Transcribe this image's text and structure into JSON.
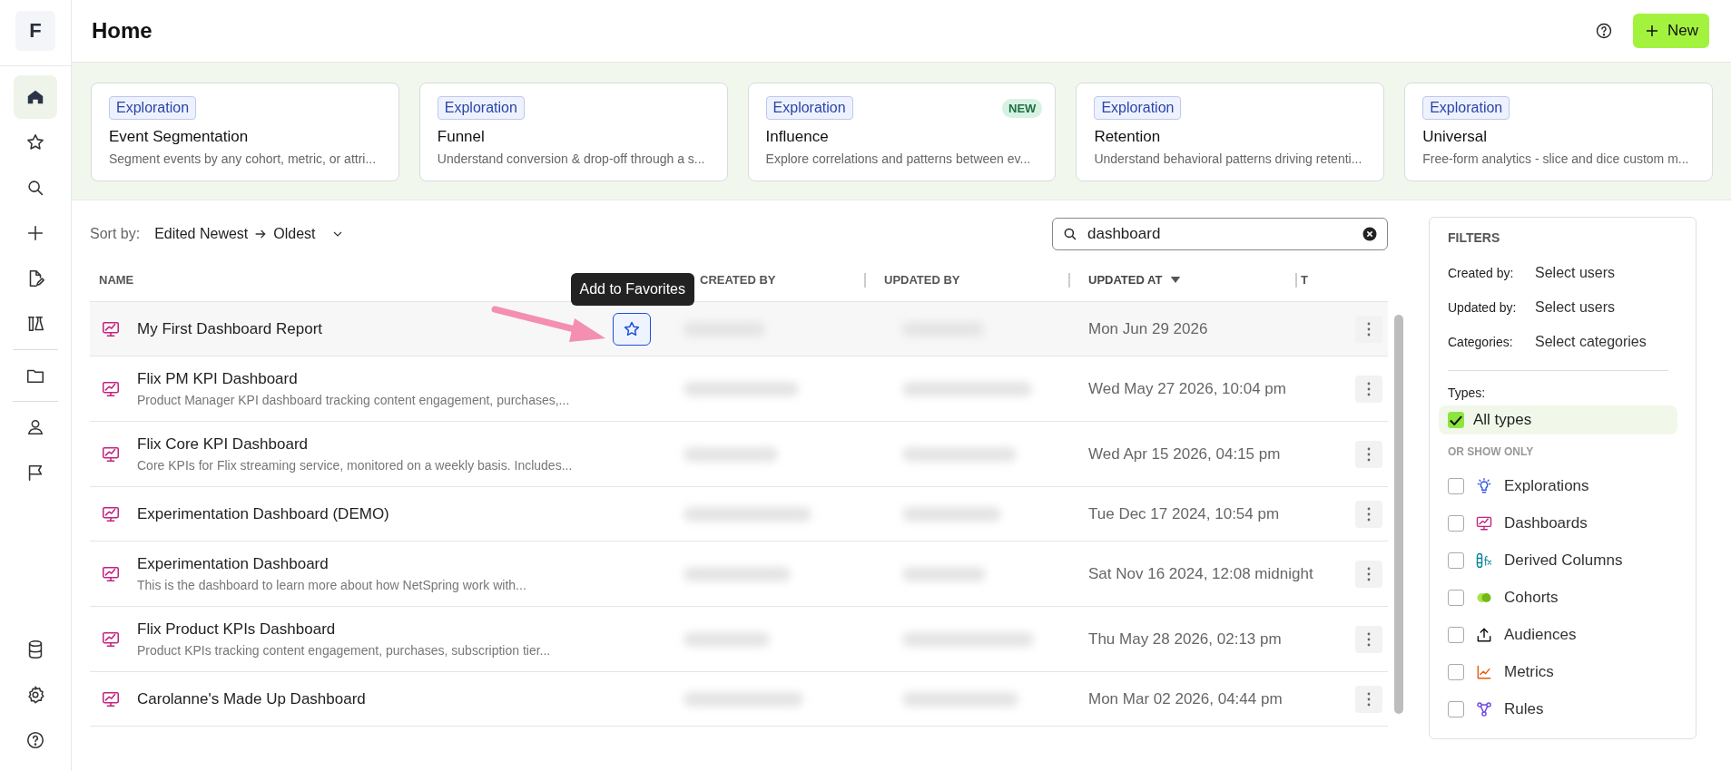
{
  "sidebar": {
    "logo": "F",
    "groups": [
      {
        "items": [
          {
            "selected": true
          },
          {
            "selected": false
          },
          {
            "selected": false
          },
          {
            "selected": false
          },
          {
            "selected": false
          },
          {
            "selected": false
          }
        ]
      },
      {
        "items": [
          {
            "selected": false
          }
        ]
      },
      {
        "items": [
          {
            "selected": false
          },
          {
            "selected": false
          }
        ]
      }
    ],
    "bottom": [
      {
        "selected": false
      },
      {
        "selected": false
      },
      {
        "selected": false
      }
    ]
  },
  "header": {
    "title": "Home",
    "new_button": "New"
  },
  "cards": [
    {
      "tag": "Exploration",
      "title": "Event Segmentation",
      "description": "Segment events by any cohort, metric, or attri..."
    },
    {
      "tag": "Exploration",
      "title": "Funnel",
      "description": "Understand conversion & drop-off through a s..."
    },
    {
      "tag": "Exploration",
      "badge": "NEW",
      "title": "Influence",
      "description": "Explore correlations and patterns between ev..."
    },
    {
      "tag": "Exploration",
      "title": "Retention",
      "description": "Understand behavioral patterns driving retenti..."
    },
    {
      "tag": "Exploration",
      "title": "Universal",
      "description": "Free-form analytics - slice and dice custom m..."
    }
  ],
  "toolbar": {
    "sort_label": "Sort by:",
    "sort_from": "Edited Newest",
    "sort_to": "Oldest",
    "search": {
      "value": "dashboard"
    }
  },
  "table": {
    "columns": [
      {
        "label": "NAME",
        "sorted": false
      },
      {
        "label": "CREATED BY",
        "sorted": false
      },
      {
        "label": "UPDATED BY",
        "sorted": false
      },
      {
        "label": "UPDATED AT",
        "sorted": true
      },
      {
        "label": "T",
        "sorted": false
      }
    ],
    "tooltip": "Add to Favorites",
    "rows": [
      {
        "name": "My First Dashboard Report",
        "hovered": true,
        "blurred": true,
        "updated_at": "Mon Jun 29 2026"
      },
      {
        "name": "Flix PM KPI Dashboard",
        "description": "Product Manager KPI dashboard tracking content engagement, purchases,...",
        "hovered": false,
        "blurred": true,
        "updated_at": "Wed May 27 2026, 10:04 pm"
      },
      {
        "name": "Flix Core KPI Dashboard",
        "description": "Core KPIs for Flix streaming service, monitored on a weekly basis. Includes...",
        "hovered": false,
        "blurred": true,
        "updated_at": "Wed Apr 15 2026, 04:15 pm"
      },
      {
        "name": "Experimentation Dashboard (DEMO)",
        "hovered": false,
        "blurred": true,
        "updated_at": "Tue Dec 17 2024, 10:54 pm"
      },
      {
        "name": "Experimentation Dashboard",
        "description": "This is the dashboard to learn more about how NetSpring work with...",
        "hovered": false,
        "blurred": true,
        "updated_at": "Sat Nov 16 2024, 12:08 midnight"
      },
      {
        "name": "Flix Product KPIs Dashboard",
        "description": "Product KPIs tracking content engagement, purchases, subscription tier...",
        "hovered": false,
        "blurred": true,
        "updated_at": "Thu May 28 2026, 02:13 pm"
      },
      {
        "name": "Carolanne's Made Up Dashboard",
        "hovered": false,
        "blurred": true,
        "updated_at": "Mon Mar 02 2026, 04:44 pm"
      }
    ]
  },
  "filters": {
    "title": "FILTERS",
    "fields": [
      {
        "label": "Created by:",
        "value": "Select users"
      },
      {
        "label": "Updated by:",
        "value": "Select users"
      },
      {
        "label": "Categories:",
        "value": "Select categories"
      }
    ],
    "types_label": "Types:",
    "all_types": {
      "label": "All types",
      "checked": true
    },
    "or_label": "OR SHOW ONLY",
    "types": [
      {
        "label": "Explorations",
        "checked": false
      },
      {
        "label": "Dashboards",
        "checked": false
      },
      {
        "label": "Derived Columns",
        "checked": false
      },
      {
        "label": "Cohorts",
        "checked": false
      },
      {
        "label": "Audiences",
        "checked": false
      },
      {
        "label": "Metrics",
        "checked": false
      },
      {
        "label": "Rules",
        "checked": false
      }
    ]
  }
}
